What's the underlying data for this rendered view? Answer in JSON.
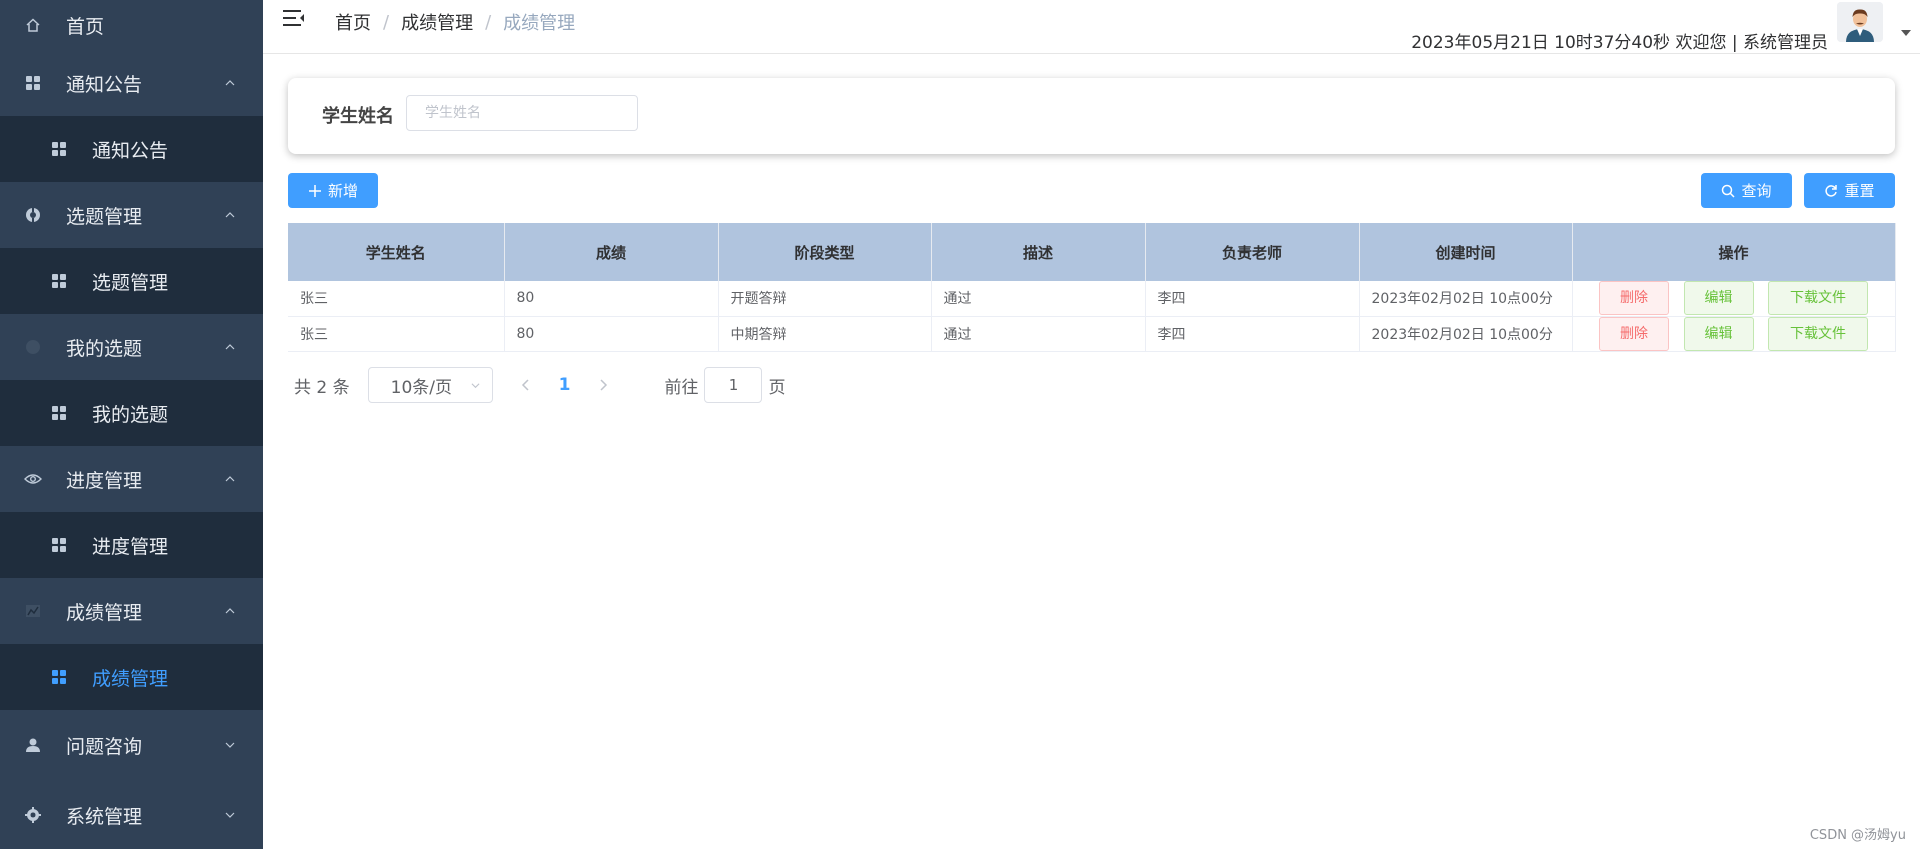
{
  "sidebar": {
    "items": [
      {
        "label": "首页",
        "type": "top",
        "icon": "home-icon"
      },
      {
        "label": "通知公告",
        "type": "group",
        "icon": "grid-icon",
        "expanded": true
      },
      {
        "label": "通知公告",
        "type": "sub",
        "icon": "grid-icon"
      },
      {
        "label": "选题管理",
        "type": "group",
        "icon": "target-icon",
        "expanded": true
      },
      {
        "label": "选题管理",
        "type": "sub",
        "icon": "grid-icon"
      },
      {
        "label": "我的选题",
        "type": "group",
        "icon": "globe-icon",
        "expanded": true
      },
      {
        "label": "我的选题",
        "type": "sub",
        "icon": "grid-icon"
      },
      {
        "label": "进度管理",
        "type": "group",
        "icon": "eye-icon",
        "expanded": true
      },
      {
        "label": "进度管理",
        "type": "sub",
        "icon": "grid-icon"
      },
      {
        "label": "成绩管理",
        "type": "group",
        "icon": "chart-icon",
        "expanded": true
      },
      {
        "label": "成绩管理",
        "type": "sub",
        "icon": "grid-icon",
        "active": true
      },
      {
        "label": "问题咨询",
        "type": "group",
        "icon": "user-icon",
        "expanded": false
      },
      {
        "label": "系统管理",
        "type": "group",
        "icon": "gear-icon",
        "expanded": false
      }
    ],
    "active_color": "#409eff",
    "background": "#304156"
  },
  "header": {
    "breadcrumb": [
      "首页",
      "成绩管理",
      "成绩管理"
    ],
    "welcome_text": "2023年05月21日 10时37分40秒 欢迎您 | 系统管理员"
  },
  "search": {
    "label": "学生姓名",
    "placeholder": "学生姓名",
    "value": ""
  },
  "toolbar": {
    "add_label": "新增",
    "query_label": "查询",
    "reset_label": "重置"
  },
  "table": {
    "columns": [
      "学生姓名",
      "成绩",
      "阶段类型",
      "描述",
      "负责老师",
      "创建时间",
      "操作"
    ],
    "rows": [
      {
        "student": "张三",
        "score": "80",
        "stage": "开题答辩",
        "desc": "通过",
        "teacher": "李四",
        "created": "2023年02月02日 10点00分"
      },
      {
        "student": "张三",
        "score": "80",
        "stage": "中期答辩",
        "desc": "通过",
        "teacher": "李四",
        "created": "2023年02月02日 10点00分"
      }
    ],
    "row_actions": {
      "delete": "删除",
      "edit": "编辑",
      "download": "下载文件"
    },
    "header_color": "#b0c4de"
  },
  "pagination": {
    "total_text": "共 2 条",
    "page_size": "10条/页",
    "current_page": "1",
    "goto_prefix": "前往",
    "goto_value": "1",
    "goto_suffix": "页"
  },
  "watermark": "CSDN @汤姆yu"
}
